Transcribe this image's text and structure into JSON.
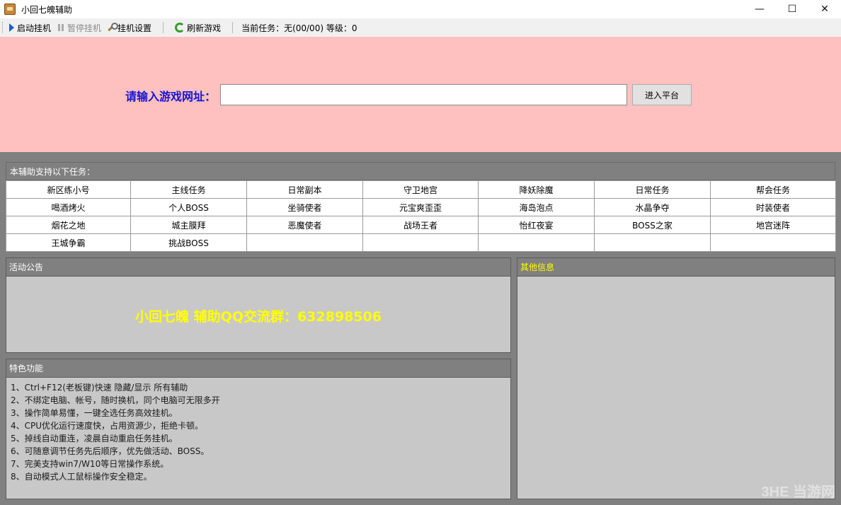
{
  "window": {
    "title": "小回七魄辅助",
    "minimize": "—",
    "maximize": "☐",
    "close": "✕"
  },
  "toolbar": {
    "start": "启动挂机",
    "pause": "暂停挂机",
    "settings": "挂机设置",
    "refresh": "刷新游戏",
    "status": "当前任务：无(00/00)  等级：0"
  },
  "url_bar": {
    "label": "请输入游戏网址：",
    "value": "",
    "button": "进入平台"
  },
  "tasks": {
    "header": "本辅助支持以下任务：",
    "rows": [
      [
        "新区练小号",
        "主线任务",
        "日常副本",
        "守卫地宫",
        "降妖除魔",
        "日常任务",
        "帮会任务"
      ],
      [
        "喝酒烤火",
        "个人BOSS",
        "坐骑使者",
        "元宝爽歪歪",
        "海岛泡点",
        "水晶争夺",
        "时装使者"
      ],
      [
        "烟花之地",
        "城主膜拜",
        "恶魔使者",
        "战场王者",
        "怡红夜宴",
        "BOSS之家",
        "地宫迷阵"
      ],
      [
        "王城争霸",
        "挑战BOSS",
        "",
        "",
        "",
        "",
        ""
      ]
    ]
  },
  "announcement": {
    "header": "活动公告",
    "text": "小回七魄 辅助QQ交流群：632898506"
  },
  "features": {
    "header": "特色功能",
    "items": [
      "1、Ctrl+F12(老板键)快速 隐藏/显示 所有辅助",
      "2、不绑定电脑、帐号，随时换机，同个电脑可无限多开",
      "3、操作简单易懂，一键全选任务高效挂机。",
      "4、CPU优化运行速度快，占用资源少，拒绝卡顿。",
      "5、掉线自动重连，凌晨自动重启任务挂机。",
      "6、可随意调节任务先后顺序，优先做活动、BOSS。",
      "7、完美支持win7/W10等日常操作系统。",
      "8、自动模式人工鼠标操作安全稳定。"
    ]
  },
  "other_info": {
    "header": "其他信息"
  },
  "watermark": "3HE 当游网",
  "colors": {
    "pink": "#ffc0c0",
    "panel_header": "#808080",
    "panel_body": "#c8c8c8",
    "notice_text": "#ffff00",
    "url_label": "#1515d6"
  }
}
